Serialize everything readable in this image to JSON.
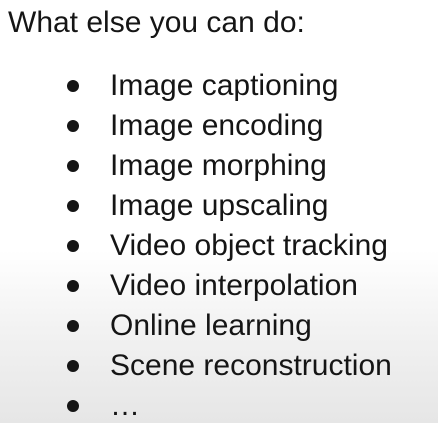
{
  "slide": {
    "title": "What else you can do:",
    "items": [
      "Image captioning",
      "Image encoding",
      "Image morphing",
      "Image upscaling",
      "Video object tracking",
      "Video interpolation",
      "Online learning",
      "Scene reconstruction",
      "…"
    ]
  }
}
